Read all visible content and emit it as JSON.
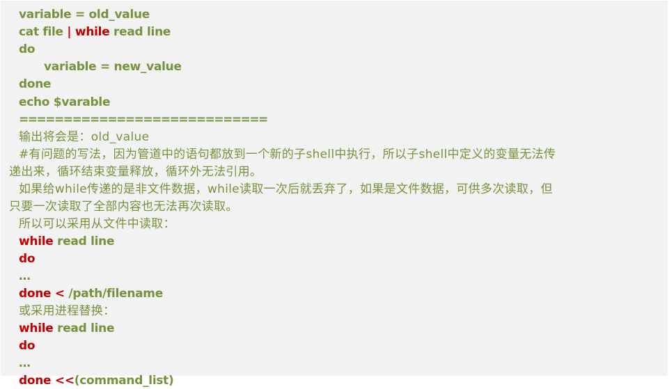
{
  "colors": {
    "text": "#76923c",
    "keyword": "#c00000",
    "background": "#f2f2f2"
  },
  "lines": [
    {
      "parts": [
        "variable = old_value"
      ]
    },
    {
      "parts": [
        "cat file ",
        "| while",
        " read line"
      ]
    },
    {
      "parts": [
        "do"
      ]
    },
    {
      "parts": [
        "variable = new_value"
      ]
    },
    {
      "parts": [
        "done"
      ]
    },
    {
      "parts": [
        "echo $varable"
      ]
    },
    {
      "parts": [
        "============================"
      ]
    },
    {
      "parts": [
        "输出将会是：old_value"
      ]
    },
    {
      "parts": [
        "#有问题的写法，因为管道中的语句都放到一个新的子shell中执行，所以子shell中定义的变量无法传"
      ]
    },
    {
      "parts": [
        "递出来，循环结束变量释放，循环外无法引用。"
      ]
    },
    {
      "parts": [
        "如果给while传递的是非文件数据，while读取一次后就丢弃了，如果是文件数据，可供多次读取，但"
      ]
    },
    {
      "parts": [
        "只要一次读取了全部内容也无法再次读取。"
      ]
    },
    {
      "parts": [
        "所以可以采用从文件中读取："
      ]
    },
    {
      "parts": [
        "while",
        " read line"
      ]
    },
    {
      "parts": [
        "do"
      ]
    },
    {
      "parts": [
        "…"
      ]
    },
    {
      "parts": [
        "done <",
        " /path/filename"
      ]
    },
    {
      "parts": [
        "或采用进程替换："
      ]
    },
    {
      "parts": [
        "while",
        " read line"
      ]
    },
    {
      "parts": [
        "do"
      ]
    },
    {
      "parts": [
        "…"
      ]
    },
    {
      "parts": [
        "done <<",
        "(command_list)"
      ]
    }
  ]
}
